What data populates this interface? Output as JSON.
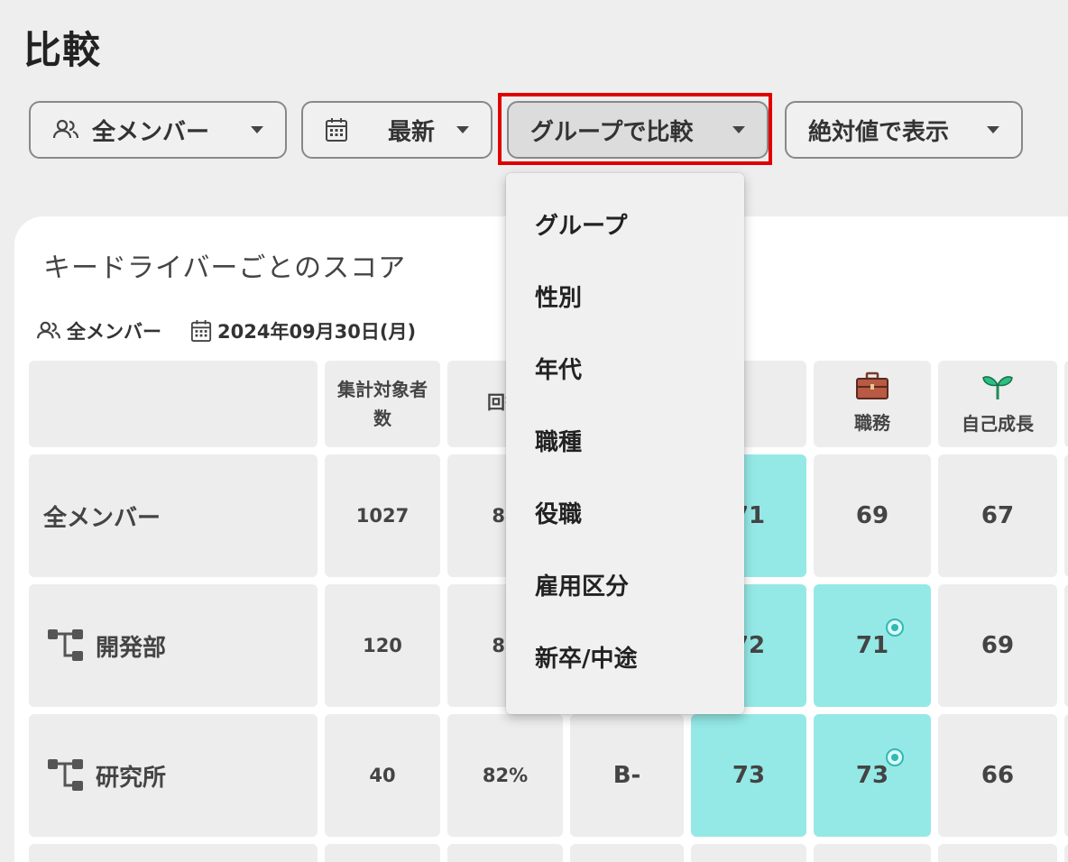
{
  "page": {
    "title": "比較"
  },
  "filters": {
    "members_label": "全メンバー",
    "period_label": "最新",
    "compare_label": "グループで比較",
    "display_label": "絶対値で表示"
  },
  "card": {
    "title": "キードライバーごとのスコア",
    "meta_members": "全メンバー",
    "meta_date": "2024年09月30日(月)"
  },
  "table": {
    "headers": {
      "count": "集計対象者数",
      "response": "回答",
      "job": "職務",
      "growth": "自己成長"
    },
    "rows": [
      {
        "name": "全メンバー",
        "count": "1027",
        "response": "84",
        "score": "71",
        "job": "69",
        "growth": "67"
      },
      {
        "name": "開発部",
        "count": "120",
        "response": "86",
        "score": "72",
        "job": "71",
        "growth": "69"
      },
      {
        "name": "研究所",
        "count": "40",
        "response": "82%",
        "grade": "B-",
        "score": "73",
        "job": "73",
        "growth": "66"
      }
    ]
  },
  "dropdown": {
    "items": [
      "グループ",
      "性別",
      "年代",
      "職種",
      "役職",
      "雇用区分",
      "新卒/中途"
    ]
  },
  "colors": {
    "highlight": "#94e9e6",
    "selection_border": "#e00000",
    "dot": "#33b8b3"
  }
}
